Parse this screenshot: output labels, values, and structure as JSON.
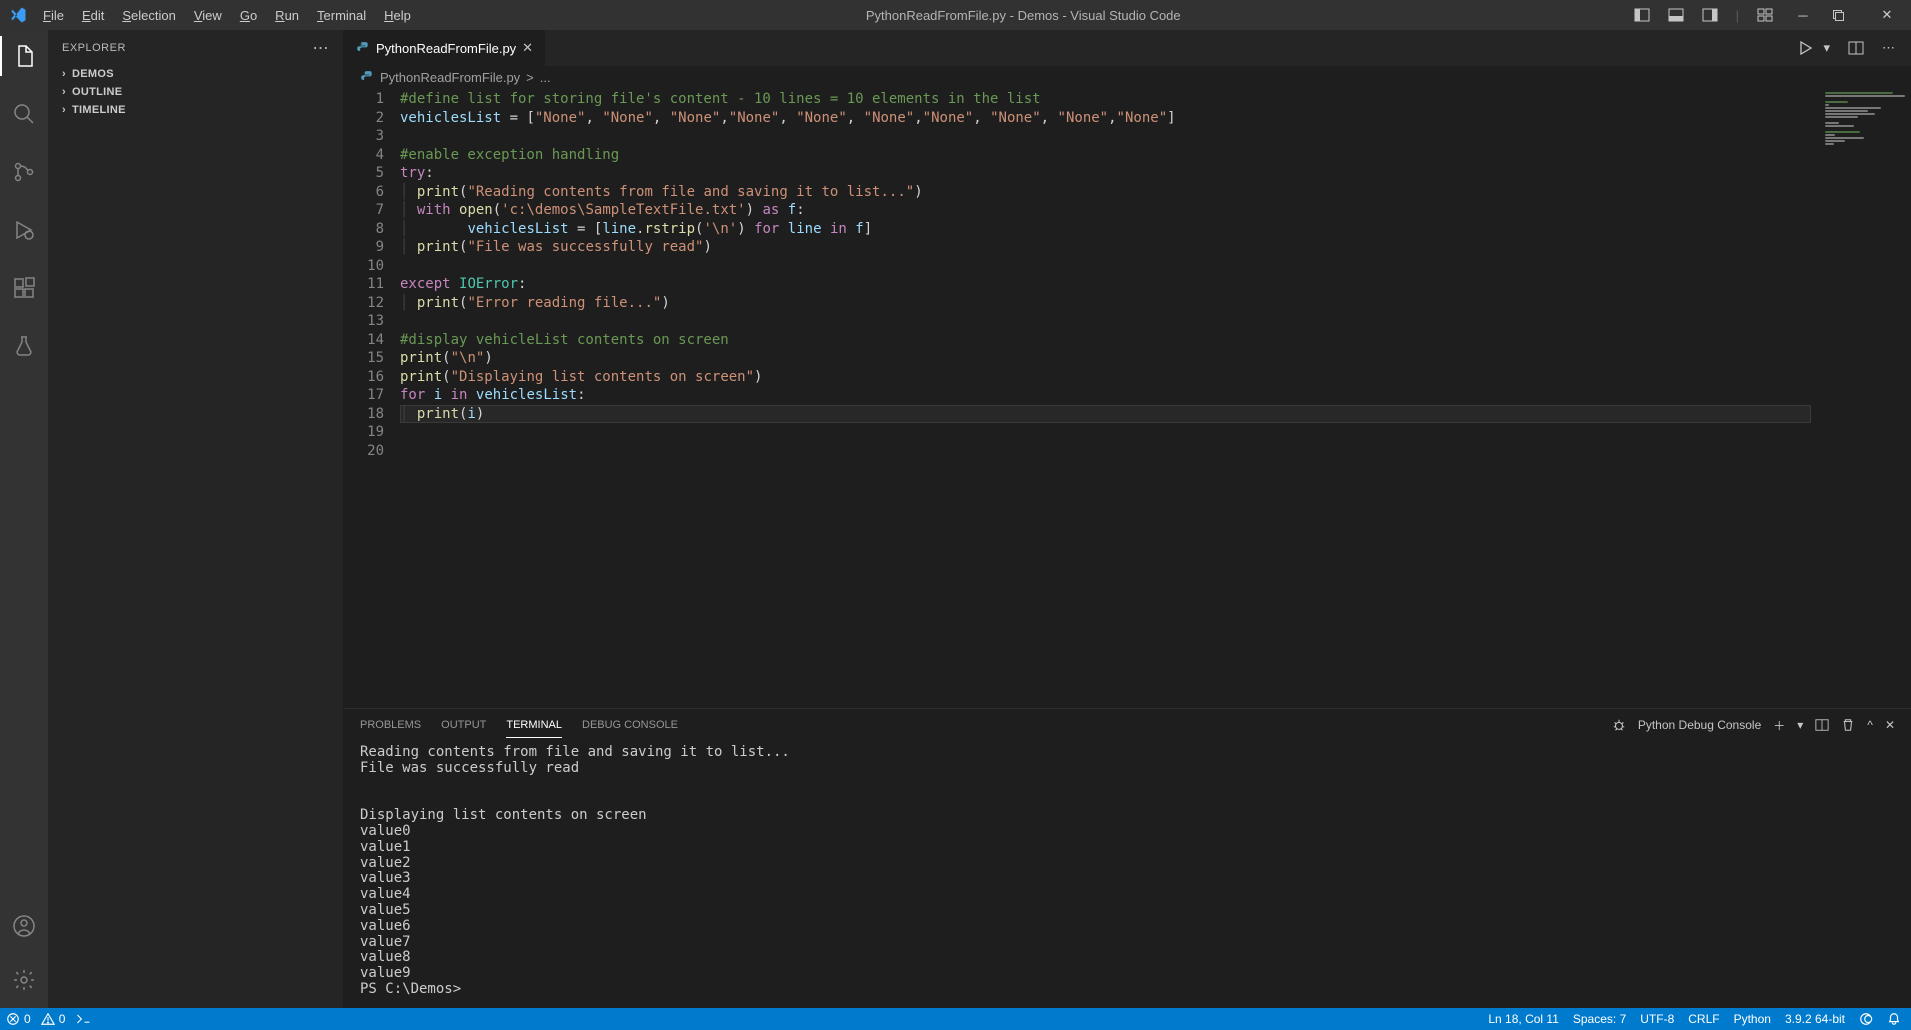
{
  "title": "PythonReadFromFile.py - Demos - Visual Studio Code",
  "menu": [
    "File",
    "Edit",
    "Selection",
    "View",
    "Go",
    "Run",
    "Terminal",
    "Help"
  ],
  "sidebar": {
    "title": "EXPLORER",
    "sections": [
      "DEMOS",
      "OUTLINE",
      "TIMELINE"
    ]
  },
  "tab": {
    "label": "PythonReadFromFile.py"
  },
  "breadcrumb": {
    "file": "PythonReadFromFile.py",
    "sep": ">",
    "tail": "..."
  },
  "code": {
    "lines": [
      [
        {
          "cls": "c-comment",
          "t": "#define list for storing file's content - 10 lines = 10 elements in the list"
        }
      ],
      [
        {
          "cls": "c-var",
          "t": "vehiclesList"
        },
        {
          "cls": "c-op",
          "t": " = ["
        },
        {
          "cls": "c-str",
          "t": "\"None\""
        },
        {
          "cls": "c-op",
          "t": ", "
        },
        {
          "cls": "c-str",
          "t": "\"None\""
        },
        {
          "cls": "c-op",
          "t": ", "
        },
        {
          "cls": "c-str",
          "t": "\"None\""
        },
        {
          "cls": "c-op",
          "t": ","
        },
        {
          "cls": "c-str",
          "t": "\"None\""
        },
        {
          "cls": "c-op",
          "t": ", "
        },
        {
          "cls": "c-str",
          "t": "\"None\""
        },
        {
          "cls": "c-op",
          "t": ", "
        },
        {
          "cls": "c-str",
          "t": "\"None\""
        },
        {
          "cls": "c-op",
          "t": ","
        },
        {
          "cls": "c-str",
          "t": "\"None\""
        },
        {
          "cls": "c-op",
          "t": ", "
        },
        {
          "cls": "c-str",
          "t": "\"None\""
        },
        {
          "cls": "c-op",
          "t": ", "
        },
        {
          "cls": "c-str",
          "t": "\"None\""
        },
        {
          "cls": "c-op",
          "t": ","
        },
        {
          "cls": "c-str",
          "t": "\"None\""
        },
        {
          "cls": "c-op",
          "t": "]"
        }
      ],
      [],
      [
        {
          "cls": "c-comment",
          "t": "#enable exception handling"
        }
      ],
      [
        {
          "cls": "c-kw",
          "t": "try"
        },
        {
          "cls": "c-op",
          "t": ":"
        }
      ],
      [
        {
          "cls": "indent-guide",
          "t": "│ "
        },
        {
          "cls": "c-fn",
          "t": "print"
        },
        {
          "cls": "c-op",
          "t": "("
        },
        {
          "cls": "c-str",
          "t": "\"Reading contents from file and saving it to list...\""
        },
        {
          "cls": "c-op",
          "t": ")"
        }
      ],
      [
        {
          "cls": "indent-guide",
          "t": "│ "
        },
        {
          "cls": "c-kw",
          "t": "with"
        },
        {
          "cls": "c-op",
          "t": " "
        },
        {
          "cls": "c-fn",
          "t": "open"
        },
        {
          "cls": "c-op",
          "t": "("
        },
        {
          "cls": "c-str",
          "t": "'c:\\demos\\SampleTextFile.txt'"
        },
        {
          "cls": "c-op",
          "t": ") "
        },
        {
          "cls": "c-kw",
          "t": "as"
        },
        {
          "cls": "c-op",
          "t": " "
        },
        {
          "cls": "c-var",
          "t": "f"
        },
        {
          "cls": "c-op",
          "t": ":"
        }
      ],
      [
        {
          "cls": "indent-guide",
          "t": "│       "
        },
        {
          "cls": "c-var",
          "t": "vehiclesList"
        },
        {
          "cls": "c-op",
          "t": " = ["
        },
        {
          "cls": "c-var",
          "t": "line"
        },
        {
          "cls": "c-op",
          "t": "."
        },
        {
          "cls": "c-fn",
          "t": "rstrip"
        },
        {
          "cls": "c-op",
          "t": "("
        },
        {
          "cls": "c-str",
          "t": "'\\n'"
        },
        {
          "cls": "c-op",
          "t": ") "
        },
        {
          "cls": "c-kw",
          "t": "for"
        },
        {
          "cls": "c-op",
          "t": " "
        },
        {
          "cls": "c-var",
          "t": "line"
        },
        {
          "cls": "c-op",
          "t": " "
        },
        {
          "cls": "c-kw",
          "t": "in"
        },
        {
          "cls": "c-op",
          "t": " "
        },
        {
          "cls": "c-var",
          "t": "f"
        },
        {
          "cls": "c-op",
          "t": "]"
        }
      ],
      [
        {
          "cls": "indent-guide",
          "t": "│ "
        },
        {
          "cls": "c-fn",
          "t": "print"
        },
        {
          "cls": "c-op",
          "t": "("
        },
        {
          "cls": "c-str",
          "t": "\"File was successfully read\""
        },
        {
          "cls": "c-op",
          "t": ")"
        }
      ],
      [],
      [
        {
          "cls": "c-kw",
          "t": "except"
        },
        {
          "cls": "c-op",
          "t": " "
        },
        {
          "cls": "c-type",
          "t": "IOError"
        },
        {
          "cls": "c-op",
          "t": ":"
        }
      ],
      [
        {
          "cls": "indent-guide",
          "t": "│ "
        },
        {
          "cls": "c-fn",
          "t": "print"
        },
        {
          "cls": "c-op",
          "t": "("
        },
        {
          "cls": "c-str",
          "t": "\"Error reading file...\""
        },
        {
          "cls": "c-op",
          "t": ")"
        }
      ],
      [],
      [
        {
          "cls": "c-comment",
          "t": "#display vehicleList contents on screen"
        }
      ],
      [
        {
          "cls": "c-fn",
          "t": "print"
        },
        {
          "cls": "c-op",
          "t": "("
        },
        {
          "cls": "c-str",
          "t": "\"\\n\""
        },
        {
          "cls": "c-op",
          "t": ")"
        }
      ],
      [
        {
          "cls": "c-fn",
          "t": "print"
        },
        {
          "cls": "c-op",
          "t": "("
        },
        {
          "cls": "c-str",
          "t": "\"Displaying list contents on screen\""
        },
        {
          "cls": "c-op",
          "t": ")"
        }
      ],
      [
        {
          "cls": "c-kw",
          "t": "for"
        },
        {
          "cls": "c-op",
          "t": " "
        },
        {
          "cls": "c-var",
          "t": "i"
        },
        {
          "cls": "c-op",
          "t": " "
        },
        {
          "cls": "c-kw",
          "t": "in"
        },
        {
          "cls": "c-op",
          "t": " "
        },
        {
          "cls": "c-var",
          "t": "vehiclesList"
        },
        {
          "cls": "c-op",
          "t": ":"
        }
      ],
      [
        {
          "cls": "indent-guide",
          "t": "│ "
        },
        {
          "cls": "c-fn",
          "t": "print"
        },
        {
          "cls": "c-op",
          "t": "("
        },
        {
          "cls": "c-var",
          "t": "i"
        },
        {
          "cls": "c-op",
          "t": ")"
        }
      ],
      [],
      []
    ],
    "current_line_index": 17
  },
  "panel": {
    "tabs": [
      "PROBLEMS",
      "OUTPUT",
      "TERMINAL",
      "DEBUG CONSOLE"
    ],
    "active": 2,
    "dropdown": "Python Debug Console",
    "terminal": "Reading contents from file and saving it to list...\nFile was successfully read\n\n\nDisplaying list contents on screen\nvalue0\nvalue1\nvalue2\nvalue3\nvalue4\nvalue5\nvalue6\nvalue7\nvalue8\nvalue9\nPS C:\\Demos>"
  },
  "status": {
    "errors": "0",
    "warnings": "0",
    "ln_col": "Ln 18, Col 11",
    "spaces": "Spaces: 7",
    "encoding": "UTF-8",
    "eol": "CRLF",
    "lang": "Python",
    "py": "3.9.2 64-bit"
  }
}
